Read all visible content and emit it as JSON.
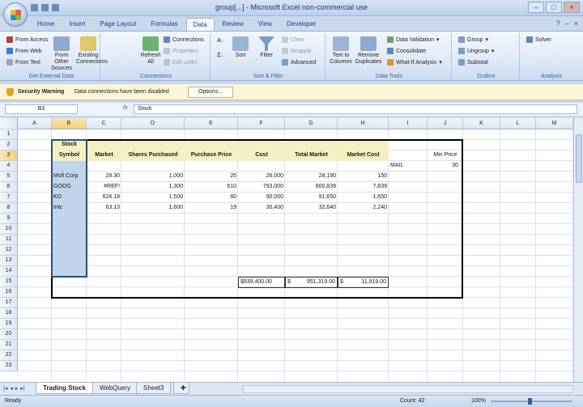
{
  "window": {
    "title": "group[...] - Microsoft Excel non-commercial use",
    "controls": [
      "–",
      "□",
      "×"
    ]
  },
  "tabs": [
    "Home",
    "Insert",
    "Page Layout",
    "Formulas",
    "Data",
    "Review",
    "View",
    "Developer"
  ],
  "active_tab": "Data",
  "ribbon": {
    "get_external": {
      "label": "Get External Data",
      "from_access": "From Access",
      "from_web": "From Web",
      "from_text": "From Text",
      "from_other": "From Other Sources",
      "existing": "Existing Connections"
    },
    "connections": {
      "label": "Connections",
      "refresh": "Refresh All",
      "connections": "Connections",
      "properties": "Properties",
      "edit_links": "Edit Links"
    },
    "sort_filter": {
      "label": "Sort & Filter",
      "sort": "Sort",
      "filter": "Filter",
      "clear": "Clear",
      "reapply": "Reapply",
      "advanced": "Advanced"
    },
    "data_tools": {
      "label": "Data Tools",
      "text_to_columns": "Text to Columns",
      "remove_duplicates": "Remove Duplicates",
      "data_validation": "Data Validation",
      "consolidate": "Consolidate",
      "what_if": "What-If Analysis"
    },
    "outline": {
      "label": "Outline",
      "group": "Group",
      "ungroup": "Ungroup",
      "subtotal": "Subtotal"
    },
    "analysis": {
      "label": "Analysis",
      "solver": "Solver"
    }
  },
  "security": {
    "title": "Security Warning",
    "message": "Data connections have been disabled",
    "options_label": "Options..."
  },
  "formula_bar": {
    "name_box": "B3",
    "fx": "fx",
    "value": "Stock"
  },
  "columns": [
    "A",
    "B",
    "C",
    "D",
    "E",
    "F",
    "G",
    "H",
    "I",
    "J",
    "K",
    "L",
    "M"
  ],
  "rows": [
    "1",
    "2",
    "3",
    "4",
    "5",
    "6",
    "7",
    "8",
    "9",
    "10",
    "11",
    "12",
    "13",
    "14",
    "15",
    "16",
    "17",
    "18",
    "19",
    "20",
    "21",
    "22",
    "23"
  ],
  "sheet": {
    "header_top": "Stock",
    "headers": [
      "Symbol",
      "Market",
      "Shares Purchased",
      "Purchase Price",
      "Cost",
      "Total Market",
      "Market Cost"
    ],
    "min_price_label": "Min Price",
    "rows": [
      [
        "Msft Corp",
        "28.30",
        "1,000",
        "26",
        "26,000",
        "28,190",
        "150"
      ],
      [
        "GOOG",
        "#REF!",
        "1,300",
        "610",
        "793,000",
        "800,839",
        "7,839"
      ],
      [
        "KO",
        "624.18",
        "1,500",
        "60",
        "90,000",
        "91,650",
        "1,650"
      ],
      [
        "Intc",
        "63.13",
        "1,600",
        "19",
        "30,400",
        "32,640",
        "2,240"
      ]
    ],
    "mail_label": "MAIL",
    "min_price_value": "30",
    "totals": [
      "$939,400.00",
      "$",
      "951,319.00",
      "$",
      "11,919.00"
    ]
  },
  "sheet_tabs": [
    "Trading Stock",
    "WebQuery",
    "Sheet3"
  ],
  "status": {
    "ready": "Ready",
    "count": "Count: 42",
    "zoom": "100%"
  }
}
